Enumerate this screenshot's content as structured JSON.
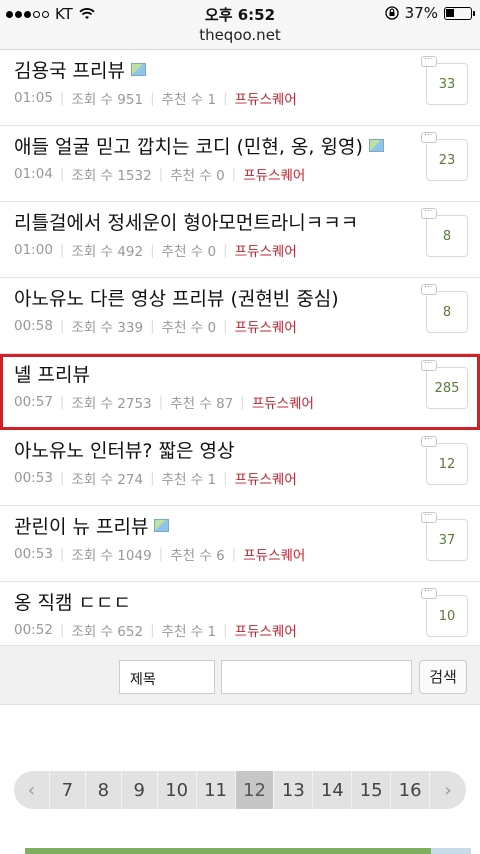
{
  "status": {
    "carrier": "KT",
    "time": "오후 6:52",
    "battery": "37%"
  },
  "browser": {
    "url": "theqoo.net"
  },
  "posts": [
    {
      "title": "김용국 프리뷰",
      "has_image": true,
      "time": "01:05",
      "views_label": "조회 수 951",
      "recommend_label": "추천 수 1",
      "category": "프듀스퀘어",
      "comments": "33"
    },
    {
      "title": "애들 얼굴 믿고 깝치는 코디 (민현, 옹, 윙영)",
      "has_image": true,
      "time": "01:04",
      "views_label": "조회 수 1532",
      "recommend_label": "추천 수 0",
      "category": "프듀스퀘어",
      "comments": "23"
    },
    {
      "title": "리틀걸에서 정세운이 형아모먼트라니ㅋㅋㅋ",
      "has_image": false,
      "time": "01:00",
      "views_label": "조회 수 492",
      "recommend_label": "추천 수 0",
      "category": "프듀스퀘어",
      "comments": "8"
    },
    {
      "title": "아노유노 다른 영상 프리뷰 (권현빈 중심)",
      "has_image": false,
      "time": "00:58",
      "views_label": "조회 수 339",
      "recommend_label": "추천 수 0",
      "category": "프듀스퀘어",
      "comments": "8"
    },
    {
      "title": "녤 프리뷰",
      "has_image": false,
      "time": "00:57",
      "views_label": "조회 수 2753",
      "recommend_label": "추천 수 87",
      "category": "프듀스퀘어",
      "comments": "285",
      "highlighted": true
    },
    {
      "title": "아노유노 인터뷰? 짧은 영상",
      "has_image": false,
      "time": "00:53",
      "views_label": "조회 수 274",
      "recommend_label": "추천 수 1",
      "category": "프듀스퀘어",
      "comments": "12"
    },
    {
      "title": "관린이 뉴 프리뷰",
      "has_image": true,
      "time": "00:53",
      "views_label": "조회 수 1049",
      "recommend_label": "추천 수 6",
      "category": "프듀스퀘어",
      "comments": "37"
    },
    {
      "title": "옹 직캠 ㄷㄷㄷ",
      "has_image": false,
      "time": "00:52",
      "views_label": "조회 수 652",
      "recommend_label": "추천 수 1",
      "category": "프듀스퀘어",
      "comments": "10"
    }
  ],
  "search": {
    "select_value": "제목",
    "input_value": "",
    "button_label": "검색"
  },
  "pagination": {
    "prev": "‹",
    "next": "›",
    "pages": [
      "7",
      "8",
      "9",
      "10",
      "11",
      "12",
      "13",
      "14",
      "15",
      "16"
    ],
    "current": "12"
  },
  "colors": {
    "category": "#c4222f",
    "highlight": "#d0202a",
    "comment_count": "#5a7a3a"
  }
}
